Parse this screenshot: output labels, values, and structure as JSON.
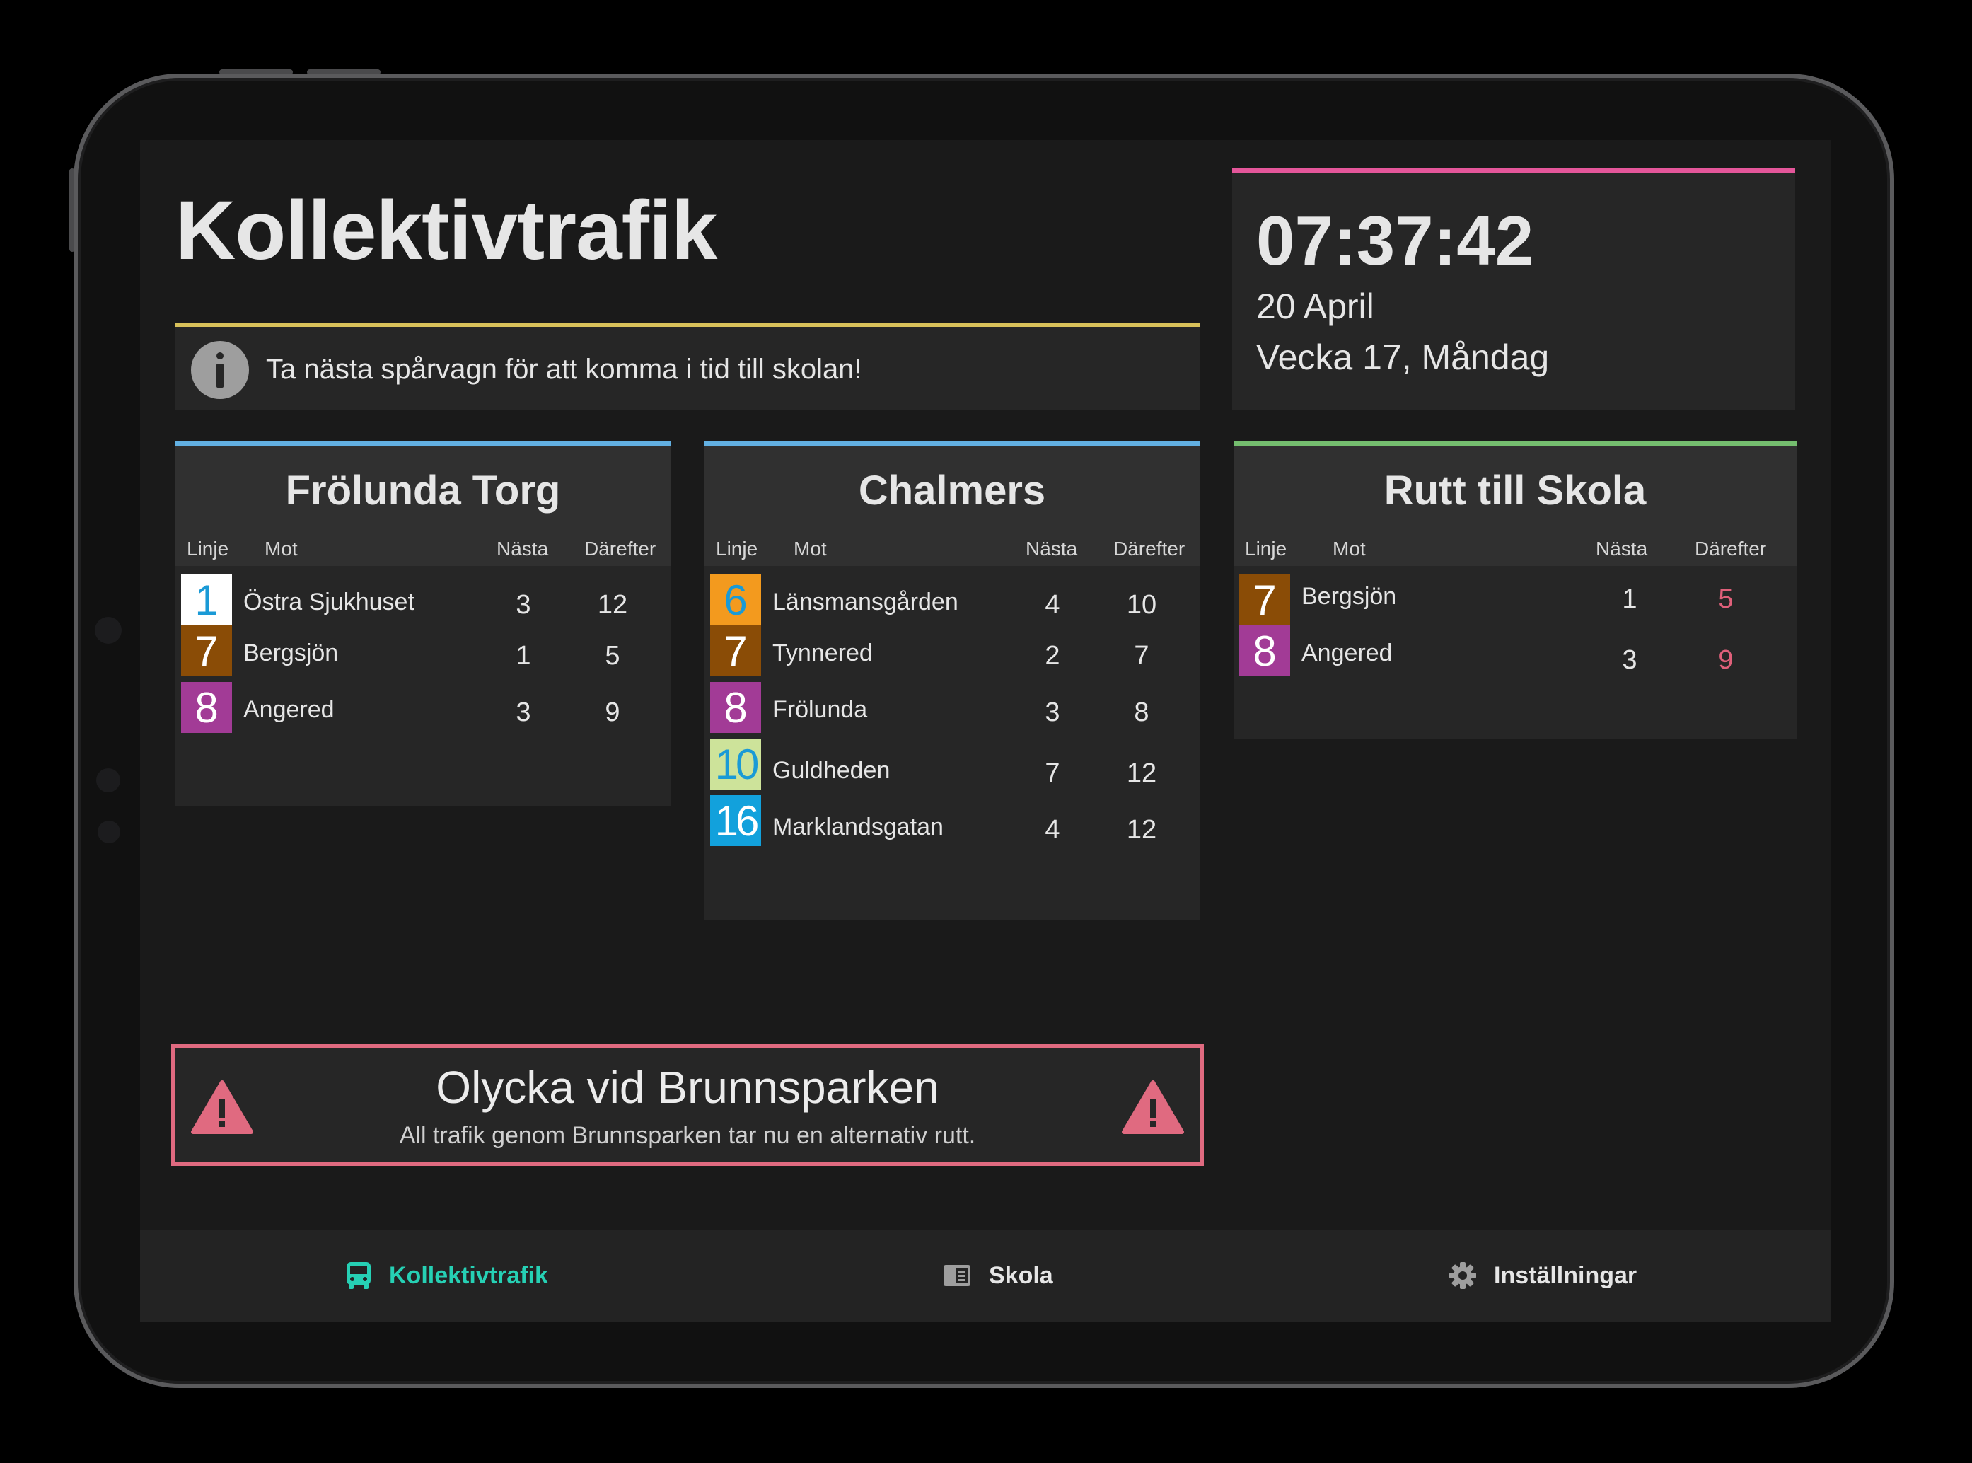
{
  "app": {
    "title": "Kollektivtrafik"
  },
  "notice": {
    "icon": "info-icon",
    "text": "Ta nästa spårvagn för att komma i tid till skolan!"
  },
  "clock": {
    "time": "07:37:42",
    "date": "20 April",
    "week": "Vecka 17, Måndag"
  },
  "columns": {
    "line": "Linje",
    "dest": "Mot",
    "next": "Nästa",
    "after": "Därefter"
  },
  "stops": [
    {
      "name": "Frölunda Torg",
      "departures": [
        {
          "line": "1",
          "dest": "Östra Sjukhuset",
          "next": "3",
          "after": "12"
        },
        {
          "line": "7",
          "dest": "Bergsjön",
          "next": "1",
          "after": "5"
        },
        {
          "line": "8",
          "dest": "Angered",
          "next": "3",
          "after": "9"
        }
      ]
    },
    {
      "name": "Chalmers",
      "departures": [
        {
          "line": "6",
          "dest": "Länsmansgården",
          "next": "4",
          "after": "10"
        },
        {
          "line": "7",
          "dest": "Tynnered",
          "next": "2",
          "after": "7"
        },
        {
          "line": "8",
          "dest": "Frölunda",
          "next": "3",
          "after": "8"
        },
        {
          "line": "10",
          "dest": "Guldheden",
          "next": "7",
          "after": "12"
        },
        {
          "line": "16",
          "dest": "Marklandsgatan",
          "next": "4",
          "after": "12"
        }
      ]
    },
    {
      "name": "Rutt till Skola",
      "departures": [
        {
          "line": "7",
          "dest": "Bergsjön",
          "next": "1",
          "after": "5"
        },
        {
          "line": "8",
          "dest": "Angered",
          "next": "3",
          "after": "9"
        }
      ]
    }
  ],
  "alert": {
    "title": "Olycka vid Brunnsparken",
    "subtitle": "All trafik genom Brunnsparken tar nu en alternativ rutt.",
    "icon": "warning-icon"
  },
  "nav": {
    "items": [
      {
        "label": "Kollektivtrafik",
        "icon": "bus-icon"
      },
      {
        "label": "Skola",
        "icon": "book-icon"
      },
      {
        "label": "Inställningar",
        "icon": "gear-icon"
      }
    ]
  },
  "colors": {
    "accent": "#26d0b4",
    "notice_bar": "#d8c15a",
    "clock_bar": "#e4569a",
    "stop_bar": "#62b0e2",
    "route_bar": "#74bd6e",
    "alert": "#e06a80",
    "line_1": "#ffffff",
    "line_6": "#f39a1e",
    "line_7": "#8a4c06",
    "line_8": "#a23b96",
    "line_10": "#cde39a",
    "line_16": "#12a1dc"
  }
}
